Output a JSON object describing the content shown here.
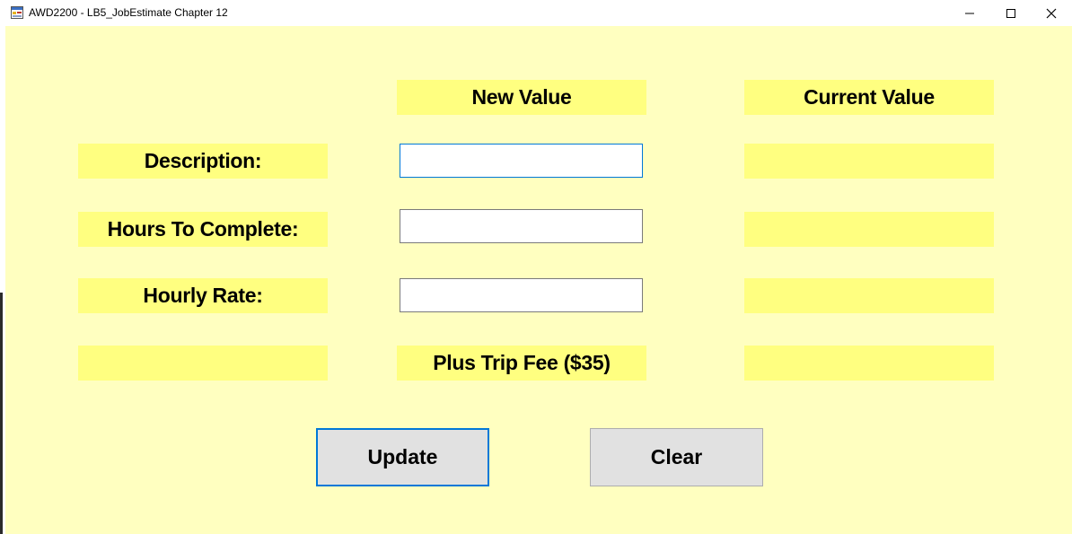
{
  "window": {
    "title": "AWD2200 - LB5_JobEstimate Chapter 12",
    "icon": "form-app-icon",
    "controls": [
      "minimize-icon",
      "maximize-icon",
      "close-icon"
    ]
  },
  "headers": {
    "new_value": "New Value",
    "current_value": "Current Value"
  },
  "rows": [
    {
      "label": "Description:",
      "input_value": "",
      "current_value": ""
    },
    {
      "label": "Hours To Complete:",
      "input_value": "",
      "current_value": ""
    },
    {
      "label": "Hourly Rate:",
      "input_value": "",
      "current_value": ""
    }
  ],
  "fee_row": {
    "label": "",
    "middle": "Plus Trip Fee ($35)",
    "current_value": ""
  },
  "buttons": {
    "update": "Update",
    "clear": "Clear"
  },
  "colors": {
    "form_background": "#ffffc0",
    "label_background": "#ffff80",
    "focus_border": "#0078d7"
  }
}
